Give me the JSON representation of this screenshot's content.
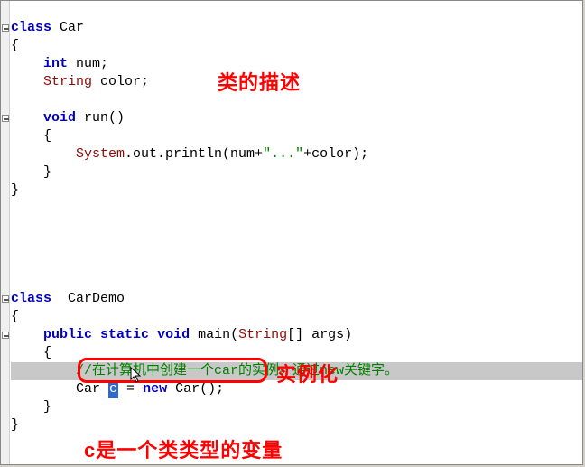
{
  "code": {
    "l1_kw": "class",
    "l1_name": " Car",
    "l2": "{",
    "l3_kw": "int",
    "l3_rest": " num;",
    "l4_type": "String",
    "l4_rest": " color;",
    "l5": "",
    "l6_kw": "void",
    "l6_rest": " run()",
    "l7": "    {",
    "l8_a": "        ",
    "l8_sys": "System",
    "l8_b": ".out.println(num+",
    "l8_str": "\"...\"",
    "l8_c": "+color);",
    "l9": "    }",
    "l10": "}",
    "l16_kw": "class",
    "l16_name": "  CarDemo",
    "l17": "{",
    "l18_pub": "public",
    "l18_sp1": " ",
    "l18_stat": "static",
    "l18_sp2": " ",
    "l18_void": "void",
    "l18_main": " main(",
    "l18_str": "String",
    "l18_args": "[] args)",
    "l19": "    {",
    "l20_cmt": "        //在计算机中创建一个car的实例。通过new关键字。",
    "l21_a": "        Car ",
    "l21_sel": "c",
    "l21_b": " = ",
    "l21_new": "new",
    "l21_c": " Car();",
    "l22": "    }",
    "l23": "}"
  },
  "annotations": {
    "class_desc": "类的描述",
    "instantiate": "实例化",
    "var_type": "c是一个类类型的变量"
  }
}
